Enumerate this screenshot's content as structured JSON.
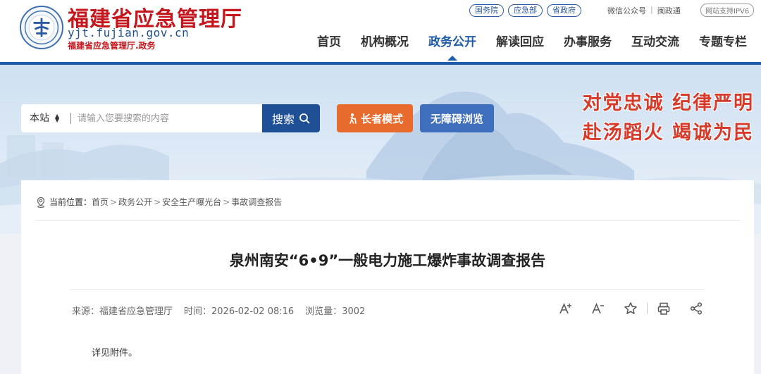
{
  "header": {
    "site_name": "福建省应急管理厅",
    "domain": "yjt.fujian.gov.cn",
    "sub_name": "福建省应急管理厅.政务",
    "top_links": [
      "国务院",
      "应急部",
      "省政府"
    ],
    "util_links": [
      "微信公众号",
      "闽政通"
    ],
    "ipv6": "网站支持IPV6",
    "nav": [
      {
        "label": "首页",
        "active": false
      },
      {
        "label": "机构概况",
        "active": false
      },
      {
        "label": "政务公开",
        "active": true
      },
      {
        "label": "解读回应",
        "active": false
      },
      {
        "label": "办事服务",
        "active": false
      },
      {
        "label": "互动交流",
        "active": false
      },
      {
        "label": "专题专栏",
        "active": false
      }
    ]
  },
  "banner": {
    "search_scope": "本站",
    "search_placeholder": "请输入您要搜索的内容",
    "search_button": "搜索",
    "elder_mode": "长者模式",
    "accessibility": "无障碍浏览",
    "slogan_line1": "对党忠诚 纪律严明",
    "slogan_line2": "赴汤蹈火 竭诚为民"
  },
  "breadcrumb": {
    "label": "当前位置：",
    "items": [
      "首页",
      "政务公开",
      "安全生产曝光台",
      "事故调查报告"
    ]
  },
  "article": {
    "title": "泉州南安“6•9”一般电力施工爆炸事故调查报告",
    "source": "来源：福建省应急管理厅",
    "time": "时间：2026-02-02 08:16",
    "views": "浏览量：3002",
    "body": "详见附件。"
  },
  "colors": {
    "brand_red": "#c4161c",
    "brand_blue": "#1f5ba8",
    "elder_orange": "#e86a2c",
    "access_blue": "#3f6ebd"
  }
}
